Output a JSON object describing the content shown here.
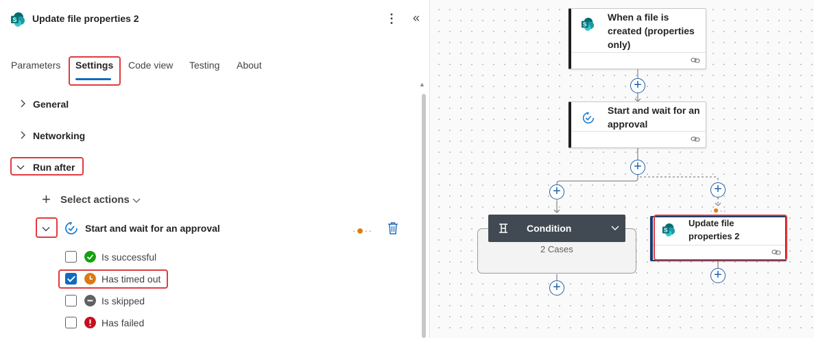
{
  "panel": {
    "title": "Update file properties 2",
    "more_icon": "more-vertical-icon",
    "collapse_icon": "double-chevron-left-icon",
    "tabs": [
      {
        "label": "Parameters",
        "active": false
      },
      {
        "label": "Settings",
        "active": true
      },
      {
        "label": "Code view",
        "active": false
      },
      {
        "label": "Testing",
        "active": false
      },
      {
        "label": "About",
        "active": false
      }
    ],
    "sections": [
      {
        "label": "General",
        "expanded": false
      },
      {
        "label": "Networking",
        "expanded": false
      },
      {
        "label": "Run after",
        "expanded": true
      }
    ],
    "select_actions": "Select actions",
    "run_after_action": {
      "label": "Start and wait for an approval",
      "statuses": [
        {
          "label": "Is successful",
          "checked": false,
          "color": "#13a10e",
          "icon": "check-circle-icon"
        },
        {
          "label": "Has timed out",
          "checked": true,
          "color": "#da7a14",
          "icon": "clock-circle-icon"
        },
        {
          "label": "Is skipped",
          "checked": false,
          "color": "#616161",
          "icon": "minus-circle-icon"
        },
        {
          "label": "Has failed",
          "checked": false,
          "color": "#c50f1f",
          "icon": "exclamation-circle-icon"
        }
      ]
    },
    "accent_color": "#0f6cbd",
    "highlight_color": "#e03a3e"
  },
  "canvas": {
    "nodes": {
      "trigger": {
        "line1": "When a file is",
        "line2": "created (properties",
        "line3": "only)"
      },
      "approval": {
        "line1": "Start and wait for an",
        "line2": "approval"
      },
      "condition": {
        "title": "Condition",
        "cases": "2 Cases"
      },
      "update": {
        "line1": "Update file",
        "line2": "properties 2"
      }
    },
    "brand_color": "#036c70"
  }
}
